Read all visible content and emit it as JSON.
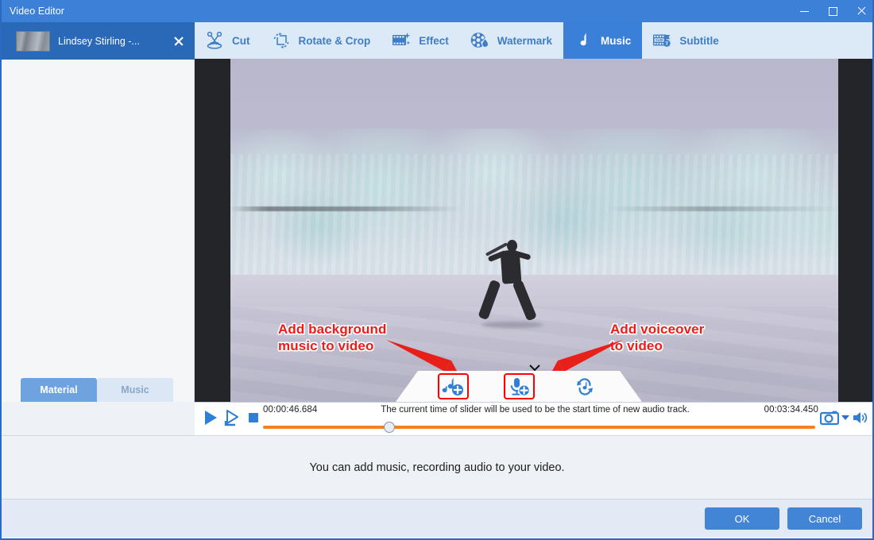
{
  "window": {
    "title": "Video Editor",
    "minimize_label": "Minimize",
    "maximize_label": "Maximize",
    "close_label": "Close"
  },
  "sidebar": {
    "file": {
      "name": "Lindsey Stirling -...",
      "close_label": "x",
      "thumb_icon": "video-thumbnail"
    },
    "tabs": [
      {
        "label": "Material",
        "active": true
      },
      {
        "label": "Music",
        "active": false
      }
    ]
  },
  "toolbar": {
    "tabs": [
      {
        "label": "Cut",
        "icon": "scissors-icon",
        "active": false
      },
      {
        "label": "Rotate & Crop",
        "icon": "rotate-crop-icon",
        "active": false
      },
      {
        "label": "Effect",
        "icon": "film-sparkle-icon",
        "active": false
      },
      {
        "label": "Watermark",
        "icon": "film-reel-drop-icon",
        "active": false
      },
      {
        "label": "Music",
        "icon": "music-note-icon",
        "active": true
      },
      {
        "label": "Subtitle",
        "icon": "subtitle-icon",
        "active": false
      }
    ]
  },
  "annotations": [
    {
      "id": "left",
      "text": "Add background\nmusic to video",
      "color": "#ef1b18"
    },
    {
      "id": "right",
      "text": "Add voiceover\nto video",
      "color": "#ef1b18"
    }
  ],
  "audio_panel": {
    "buttons": [
      {
        "name": "add-background-music-button",
        "icon": "music-note-plus-icon",
        "highlighted": true
      },
      {
        "name": "add-voiceover-button",
        "icon": "microphone-plus-icon",
        "highlighted": true
      },
      {
        "name": "replace-audio-button",
        "icon": "audio-swap-icon",
        "highlighted": false
      }
    ],
    "collapse_icon": "chevron-down-icon"
  },
  "transport": {
    "play_label": "Play",
    "play_selection_label": "Play selection",
    "stop_label": "Stop",
    "current_time": "00:00:46.684",
    "total_time": "00:03:34.450",
    "hint": "The current time of slider will be used to be the start time of new audio track.",
    "slider_percent": 22,
    "track_color": "#f58220",
    "snapshot_icon": "camera-icon",
    "snapshot_dropdown_icon": "caret-down-icon",
    "volume_icon": "speaker-icon"
  },
  "lower": {
    "message": "You can add music, recording audio to your video."
  },
  "footer": {
    "ok_label": "OK",
    "cancel_label": "Cancel"
  },
  "theme": {
    "title_bar": "#3c80d8",
    "accent": "#4285d6",
    "toolbar_bg": "#dce9f7",
    "active_tab": "#3b80d8",
    "annotation_red": "#ef1b18",
    "slider_orange": "#f58220"
  }
}
